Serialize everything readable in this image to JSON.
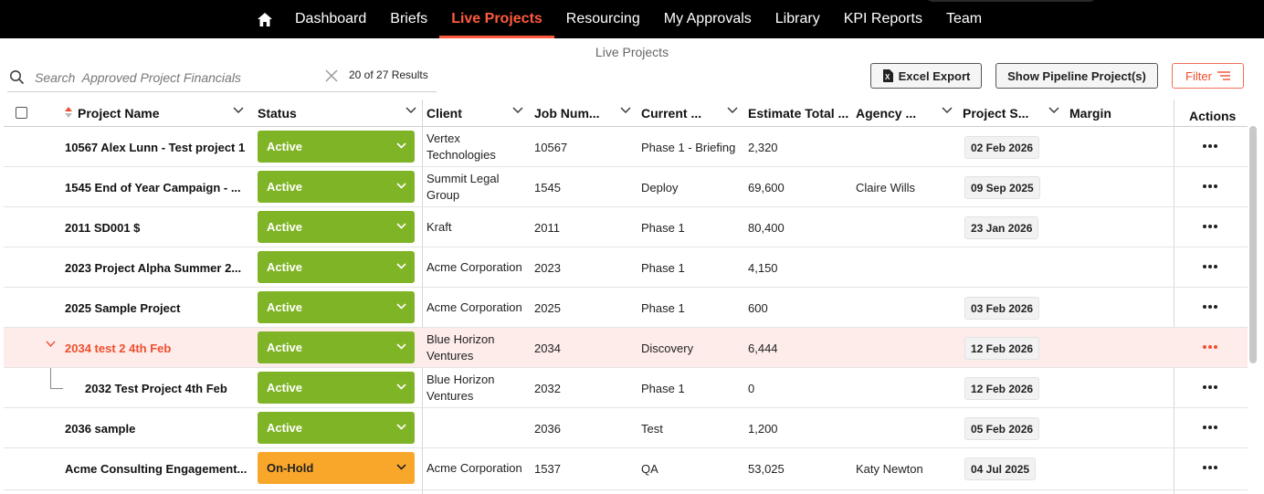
{
  "nav": {
    "items": [
      {
        "label": "Dashboard",
        "active": false
      },
      {
        "label": "Briefs",
        "active": false
      },
      {
        "label": "Live Projects",
        "active": true
      },
      {
        "label": "Resourcing",
        "active": false
      },
      {
        "label": "My Approvals",
        "active": false
      },
      {
        "label": "Library",
        "active": false
      },
      {
        "label": "KPI Reports",
        "active": false
      },
      {
        "label": "Team",
        "active": false
      }
    ],
    "accent": "#ff5a3d"
  },
  "page": {
    "title": "Live Projects"
  },
  "search": {
    "placeholder": "Search  Approved Project Financials",
    "value": "",
    "results": "20 of 27 Results"
  },
  "toolbar": {
    "excel_label": "Excel Export",
    "pipeline_label": "Show Pipeline Project(s)",
    "filter_label": "Filter"
  },
  "table": {
    "columns": {
      "project_name": "Project Name",
      "status": "Status",
      "client": "Client",
      "job_number": "Job Num...",
      "current_phase": "Current ...",
      "estimate_total": "Estimate Total ...",
      "agency": "Agency ...",
      "project_start": "Project S...",
      "margin": "Margin",
      "actions": "Actions"
    },
    "rows": [
      {
        "name": "10567 Alex Lunn - Test project 1",
        "status": "Active",
        "client": "Vertex Technologies",
        "job": "10567",
        "phase": "Phase 1 - Briefing",
        "estimate": "2,320",
        "agency": "",
        "start": "02 Feb 2026"
      },
      {
        "name": "1545 End of Year Campaign - ...",
        "status": "Active",
        "client": "Summit Legal Group",
        "job": "1545",
        "phase": "Deploy",
        "estimate": "69,600",
        "agency": "Claire Wills",
        "start": "09 Sep 2025"
      },
      {
        "name": "2011 SD001 $",
        "status": "Active",
        "client": "Kraft",
        "job": "2011",
        "phase": "Phase 1",
        "estimate": "80,400",
        "agency": "",
        "start": "23 Jan 2026"
      },
      {
        "name": "2023 Project Alpha Summer 2...",
        "status": "Active",
        "client": "Acme Corporation",
        "job": "2023",
        "phase": "Phase 1",
        "estimate": "4,150",
        "agency": "",
        "start": ""
      },
      {
        "name": "2025 Sample Project",
        "status": "Active",
        "client": "Acme Corporation",
        "job": "2025",
        "phase": "Phase 1",
        "estimate": "600",
        "agency": "",
        "start": "03 Feb 2026"
      },
      {
        "name": "2034 test 2 4th Feb",
        "status": "Active",
        "client": "Blue Horizon Ventures",
        "job": "2034",
        "phase": "Discovery",
        "estimate": "6,444",
        "agency": "",
        "start": "12 Feb 2026"
      },
      {
        "name": "2032 Test Project 4th Feb",
        "status": "Active",
        "client": "Blue Horizon Ventures",
        "job": "2032",
        "phase": "Phase 1",
        "estimate": "0",
        "agency": "",
        "start": "12 Feb 2026"
      },
      {
        "name": "2036 sample",
        "status": "Active",
        "client": "",
        "job": "2036",
        "phase": "Test",
        "estimate": "1,200",
        "agency": "",
        "start": "05 Feb 2026"
      },
      {
        "name": "Acme Consulting Engagement...",
        "status": "On-Hold",
        "client": "Acme Corporation",
        "job": "1537",
        "phase": "QA",
        "estimate": "53,025",
        "agency": "Katy Newton",
        "start": "04 Jul 2025"
      }
    ]
  },
  "colors": {
    "active_status": "#80b427",
    "hold_status": "#f9a72b",
    "highlight_row": "#fdecea",
    "accent": "#f04e2f"
  }
}
